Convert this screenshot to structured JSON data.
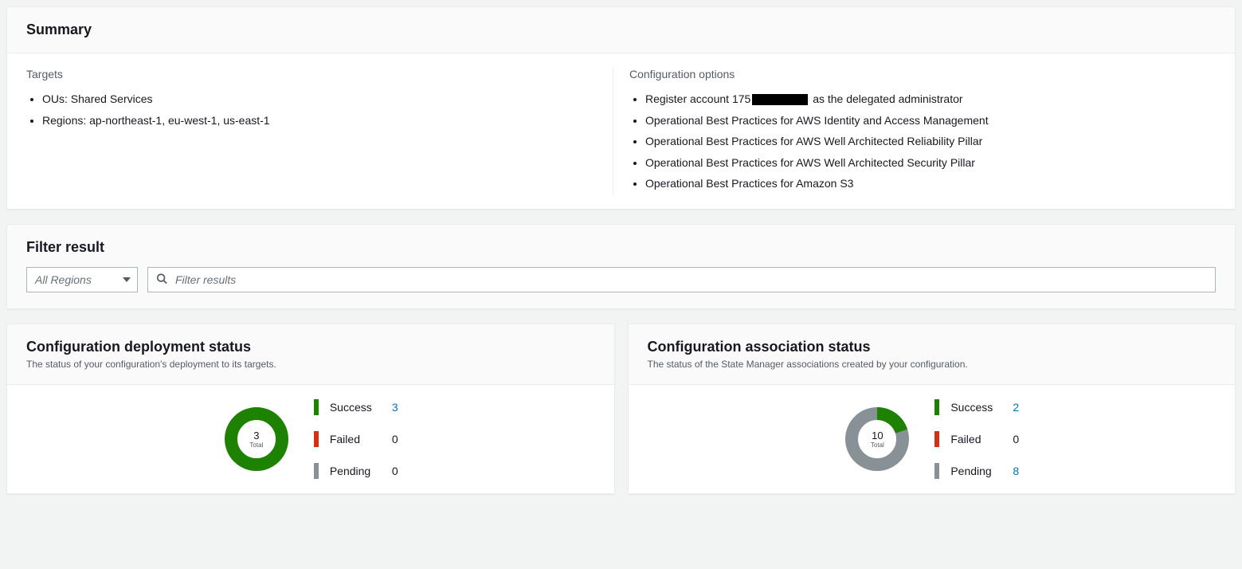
{
  "summary": {
    "title": "Summary",
    "targets_heading": "Targets",
    "targets": [
      "OUs: Shared Services",
      "Regions: ap-northeast-1, eu-west-1, us-east-1"
    ],
    "config_heading": "Configuration options",
    "config_opt_prefix": "Register account 175",
    "config_opt_suffix": " as the delegated administrator",
    "config_options_rest": [
      "Operational Best Practices for AWS Identity and Access Management",
      "Operational Best Practices for AWS Well Architected Reliability Pillar",
      "Operational Best Practices for AWS Well Architected Security Pillar",
      "Operational Best Practices for Amazon S3"
    ]
  },
  "filter": {
    "title": "Filter result",
    "region_placeholder": "All Regions",
    "search_placeholder": "Filter results"
  },
  "deploy_status": {
    "title": "Configuration deployment status",
    "subtitle": "The status of your configuration's deployment to its targets.",
    "total": "3",
    "total_label": "Total",
    "success_label": "Success",
    "success_value": "3",
    "failed_label": "Failed",
    "failed_value": "0",
    "pending_label": "Pending",
    "pending_value": "0"
  },
  "assoc_status": {
    "title": "Configuration association status",
    "subtitle": "The status of the State Manager associations created by your configuration.",
    "total": "10",
    "total_label": "Total",
    "success_label": "Success",
    "success_value": "2",
    "failed_label": "Failed",
    "failed_value": "0",
    "pending_label": "Pending",
    "pending_value": "8"
  },
  "colors": {
    "success": "#1d8102",
    "failed": "#d13212",
    "pending": "#879196",
    "link": "#0073bb"
  },
  "chart_data": [
    {
      "type": "pie",
      "title": "Configuration deployment status",
      "series": [
        {
          "name": "Success",
          "value": 3
        },
        {
          "name": "Failed",
          "value": 0
        },
        {
          "name": "Pending",
          "value": 0
        }
      ],
      "total": 3
    },
    {
      "type": "pie",
      "title": "Configuration association status",
      "series": [
        {
          "name": "Success",
          "value": 2
        },
        {
          "name": "Failed",
          "value": 0
        },
        {
          "name": "Pending",
          "value": 8
        }
      ],
      "total": 10
    }
  ]
}
